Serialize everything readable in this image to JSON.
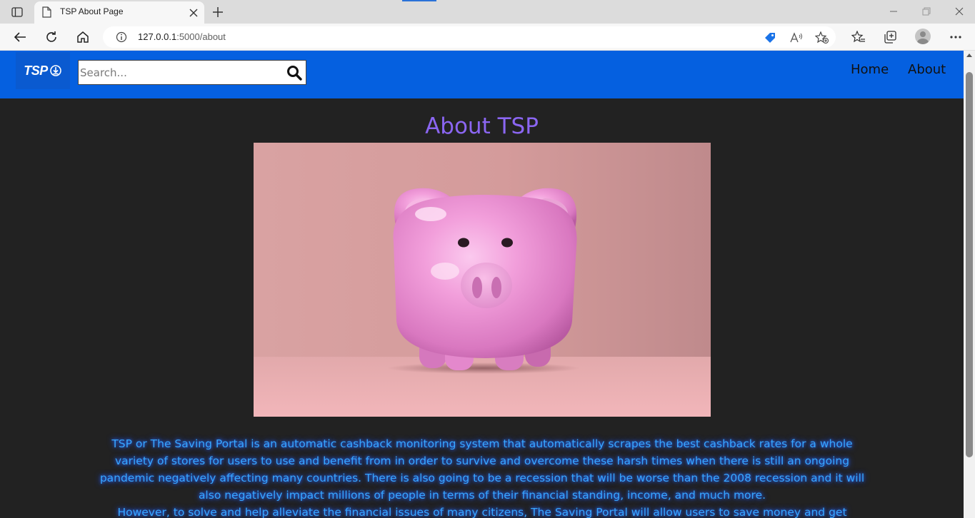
{
  "browser": {
    "tab_title": "TSP About Page",
    "url_host": "127.0.0.1",
    "url_rest": ":5000/about",
    "accent_color": "#2b72d8"
  },
  "navbar": {
    "brand": "TSP",
    "search_placeholder": "Search...",
    "links": [
      "Home",
      "About"
    ],
    "background_color": "#0560e0"
  },
  "main": {
    "title": "About TSP",
    "title_color": "#8b66f2",
    "image_subject": "pink piggy bank on pink background",
    "paragraph1": "TSP or The Saving Portal is an automatic cashback monitoring system that automatically scrapes the best cashback rates for a whole variety of stores for users to use and benefit from in order to survive and overcome these harsh times when there is still an ongoing pandemic negatively affecting many countries. There is also going to be a recession that will be worse than the 2008 recession and it will also negatively impact millions of people in terms of their financial standing, income, and much more.",
    "paragraph2": "However, to solve and help alleviate the financial issues of many citizens, The Saving Portal will allow users to save money and get",
    "text_color": "#37a6ff"
  }
}
